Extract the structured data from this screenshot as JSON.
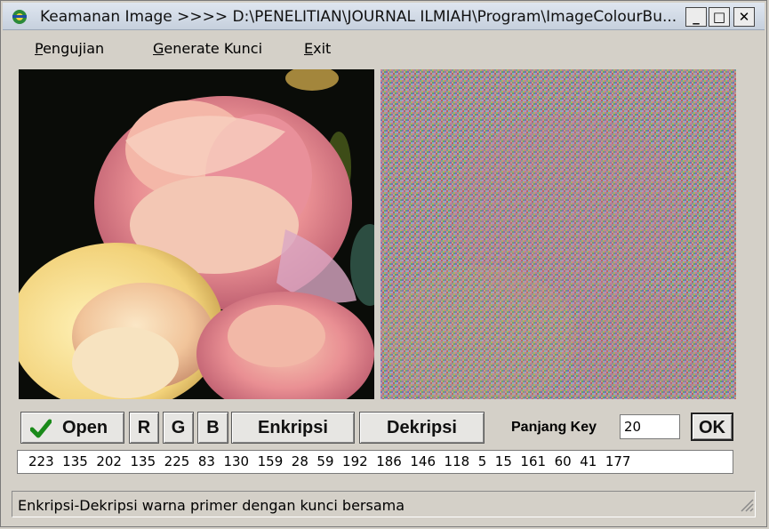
{
  "window": {
    "title": "Keamanan Image >>>> D:\\PENELITIAN\\JOURNAL ILMIAH\\Program\\ImageColourBu...",
    "min_label": "_",
    "max_label": "□",
    "close_label": "✕"
  },
  "menu": {
    "items": [
      {
        "accel": "P",
        "rest": "engujian"
      },
      {
        "accel": "G",
        "rest": "enerate Kunci"
      },
      {
        "accel": "E",
        "rest": "xit"
      }
    ]
  },
  "toolbar": {
    "open_label": "Open",
    "r_label": "R",
    "g_label": "G",
    "b_label": "B",
    "enkripsi_label": "Enkripsi",
    "dekripsi_label": "Dekripsi",
    "key_length_label": "Panjang Key",
    "key_length_value": "20",
    "ok_label": "OK"
  },
  "key_values": "223  135  202  135  225  83  130  159  28  59  192  186  146  118  5  15  161  60  41  177",
  "status": {
    "text": "Enkripsi-Dekripsi warna primer dengan kunci bersama"
  },
  "colors": {
    "accent_check": "#1a8a1a",
    "window_bg": "#d4d0c8"
  }
}
